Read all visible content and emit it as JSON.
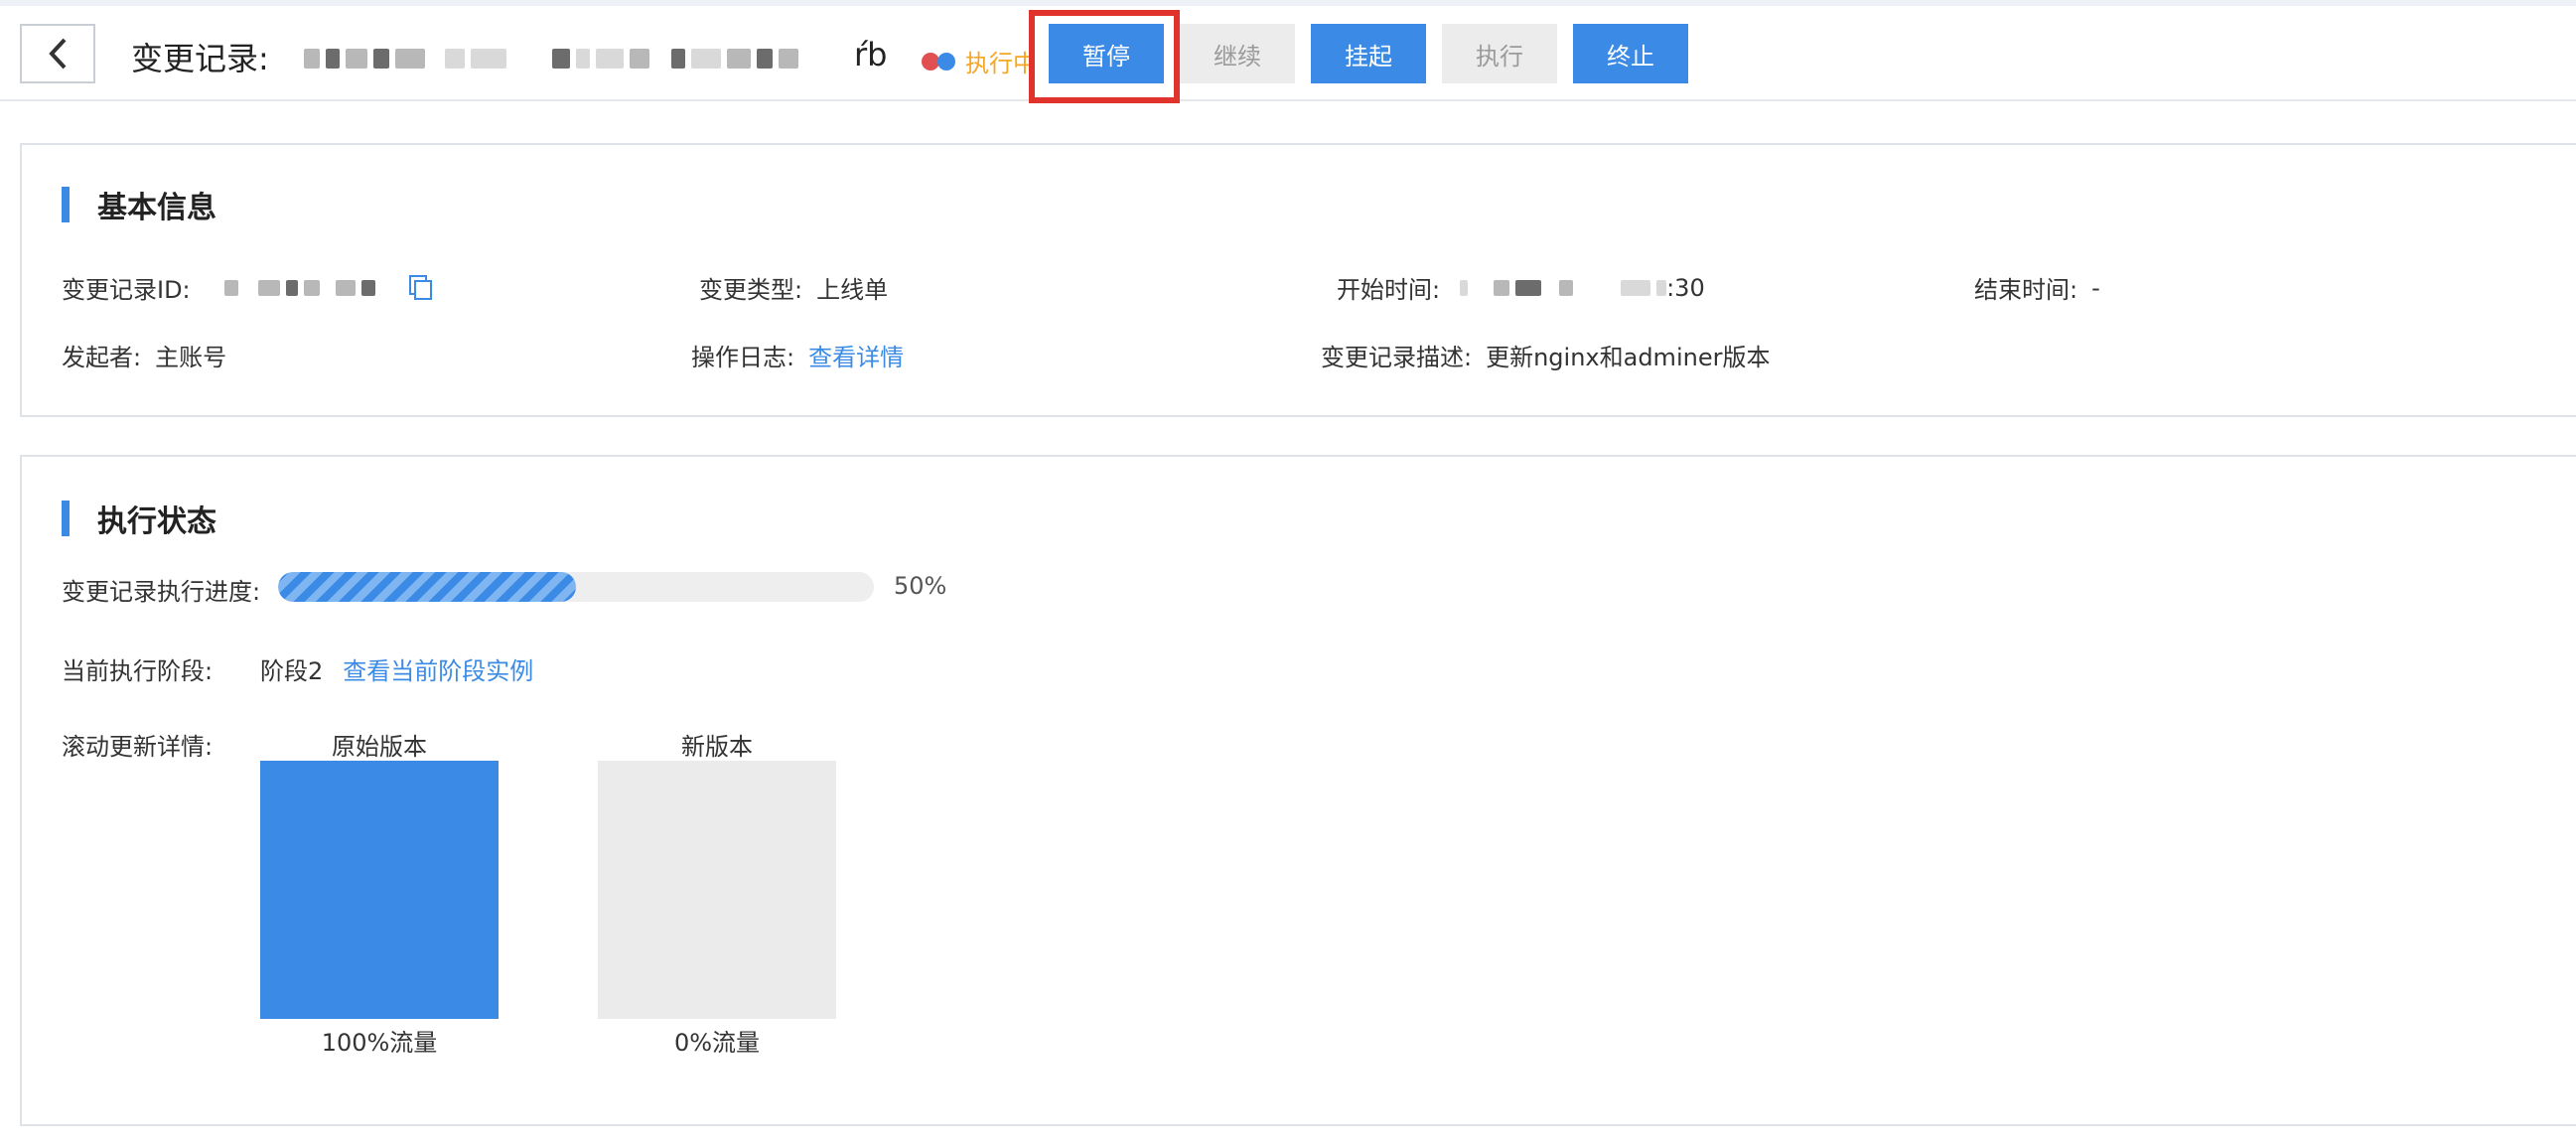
{
  "header": {
    "title": "变更记录:",
    "title_tail": "ŕb",
    "status_text": "执行中",
    "buttons": [
      {
        "label": "暂停",
        "state": "primary"
      },
      {
        "label": "继续",
        "state": "disabled"
      },
      {
        "label": "挂起",
        "state": "primary"
      },
      {
        "label": "执行",
        "state": "disabled"
      },
      {
        "label": "终止",
        "state": "primary"
      }
    ]
  },
  "basic_info": {
    "title": "基本信息",
    "record_id_label": "变更记录ID:",
    "change_type_label": "变更类型:",
    "change_type_value": "上线单",
    "start_time_label": "开始时间:",
    "start_time_tail": ":30",
    "end_time_label": "结束时间:",
    "end_time_value": "-",
    "initiator_label": "发起者:",
    "initiator_value": "主账号",
    "log_label": "操作日志:",
    "log_link": "查看详情",
    "desc_label": "变更记录描述:",
    "desc_value": "更新nginx和adminer版本"
  },
  "exec_status": {
    "title": "执行状态",
    "progress_label": "变更记录执行进度:",
    "progress_percent": 50,
    "progress_text": "50%",
    "stage_label": "当前执行阶段:",
    "stage_value": "阶段2",
    "stage_link": "查看当前阶段实例",
    "rolling_label": "滚动更新详情:",
    "versions": [
      {
        "label": "原始版本",
        "traffic": "100%流量",
        "color": "#3b8be6"
      },
      {
        "label": "新版本",
        "traffic": "0%流量",
        "color": "#ebebeb"
      }
    ]
  },
  "colors": {
    "accent": "#3b8be6",
    "status_orange": "#f5a623",
    "highlight_red": "#e0332b"
  }
}
